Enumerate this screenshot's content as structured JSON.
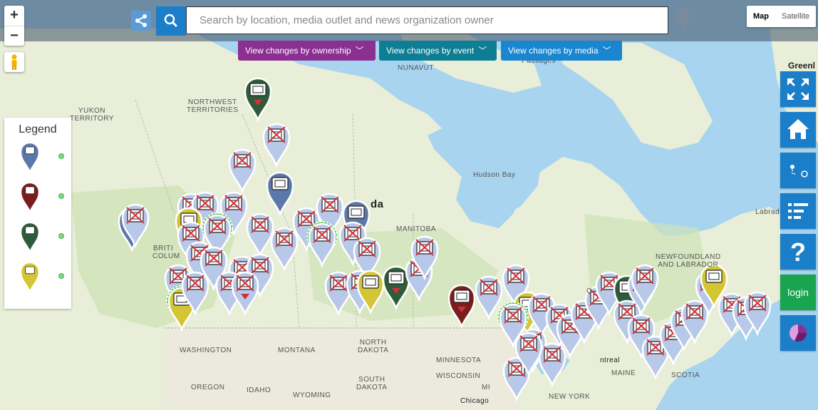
{
  "map": {
    "zoom_in": "+",
    "zoom_out": "−",
    "map_type_options": [
      "Map",
      "Satellite"
    ],
    "map_type_selected": "Map",
    "labels": [
      {
        "id": "nunavut",
        "text": "NUNAVUT"
      },
      {
        "id": "passages",
        "text": "Passages"
      },
      {
        "id": "yukon",
        "text": "YUKON\nTERRITORY"
      },
      {
        "id": "nwt",
        "text": "NORTHWEST\nTERRITORIES"
      },
      {
        "id": "hudson",
        "text": "Hudson Bay"
      },
      {
        "id": "canada",
        "text": "da"
      },
      {
        "id": "manitoba",
        "text": "MANITOBA"
      },
      {
        "id": "british",
        "text": "BRITI"
      },
      {
        "id": "colum",
        "text": "COLUM"
      },
      {
        "id": "labrad",
        "text": "Labrad"
      },
      {
        "id": "newfoundland",
        "text": "NEWFOUNDLAND\nAND LABRADOR"
      },
      {
        "id": "washington",
        "text": "WASHINGTON"
      },
      {
        "id": "montana",
        "text": "MONTANA"
      },
      {
        "id": "north_dakota",
        "text": "NORTH\nDAKOTA"
      },
      {
        "id": "south_dakota",
        "text": "SOUTH\nDAKOTA"
      },
      {
        "id": "minnesota",
        "text": "MINNESOTA"
      },
      {
        "id": "wisconsin",
        "text": "WISCONSIN"
      },
      {
        "id": "oregon",
        "text": "OREGON"
      },
      {
        "id": "idaho",
        "text": "IDAHO"
      },
      {
        "id": "wyoming",
        "text": "WYOMING"
      },
      {
        "id": "chicago",
        "text": "Chicago"
      },
      {
        "id": "new_york",
        "text": "NEW YORK"
      },
      {
        "id": "maine",
        "text": "MAINE"
      },
      {
        "id": "ntreal",
        "text": "ntreal"
      },
      {
        "id": "scotia",
        "text": "SCOTIA"
      },
      {
        "id": "mi",
        "text": "MI"
      },
      {
        "id": "qc",
        "text": "Q"
      }
    ]
  },
  "search": {
    "placeholder": "Search by location, media outlet and news organization owner"
  },
  "filters": {
    "ownership": "View changes by ownership",
    "event": "View changes by event",
    "media": "View changes by media"
  },
  "legend": {
    "title": "Legend",
    "items": [
      {
        "icon": "newspaper-icon",
        "color": "#5a78a8"
      },
      {
        "icon": "radio-tower-icon",
        "color": "#7a1d1d"
      },
      {
        "icon": "tv-icon",
        "color": "#2e5c3a"
      },
      {
        "icon": "online-media-icon",
        "color": "#d4c534"
      }
    ]
  },
  "greenland_label": "Greenl",
  "toolbar": {
    "login_label": "login",
    "help_glyph": "?",
    "buttons": [
      "fullscreen-icon",
      "home-icon",
      "route-icon",
      "list-icon",
      "help-icon",
      "login-button",
      "pie-chart-icon"
    ]
  },
  "pin_colors": {
    "closed": "#b8c8e8",
    "newspaper": "#5a78a8",
    "radio": "#7a1d1d",
    "tv": "#2e5c3a",
    "online": "#d4c534",
    "closed_mark": "#d0303c",
    "new_badge": "#3cc33c"
  }
}
